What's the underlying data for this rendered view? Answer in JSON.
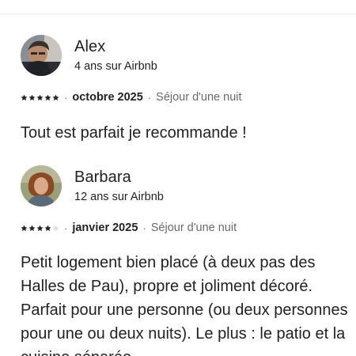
{
  "reviews": [
    {
      "name": "Alex",
      "tenure": "4 ans sur Airbnb",
      "rating": 5,
      "date": "octobre 2025",
      "stay": "Séjour d'une nuit",
      "text": "Tout est parfait je recommande !",
      "avatar_icon": "profile-photo"
    },
    {
      "name": "Barbara",
      "tenure": "12 ans sur Airbnb",
      "rating": 4,
      "date": "janvier 2025",
      "stay": "Séjour d'une nuit",
      "text": "Petit logement bien placé (à deux pas des Halles de Pau), propre et joliment décoré. Parfait pour une personne (ou deux personnes pour une ou deux nuits). Le plus : le patio et la cuisine séparée.",
      "avatar_icon": "profile-photo"
    }
  ],
  "separator": "·",
  "colors": {
    "text": "#222222",
    "secondary": "#6a6a6a",
    "star_filled": "#222222",
    "star_empty": "#dddddd"
  }
}
